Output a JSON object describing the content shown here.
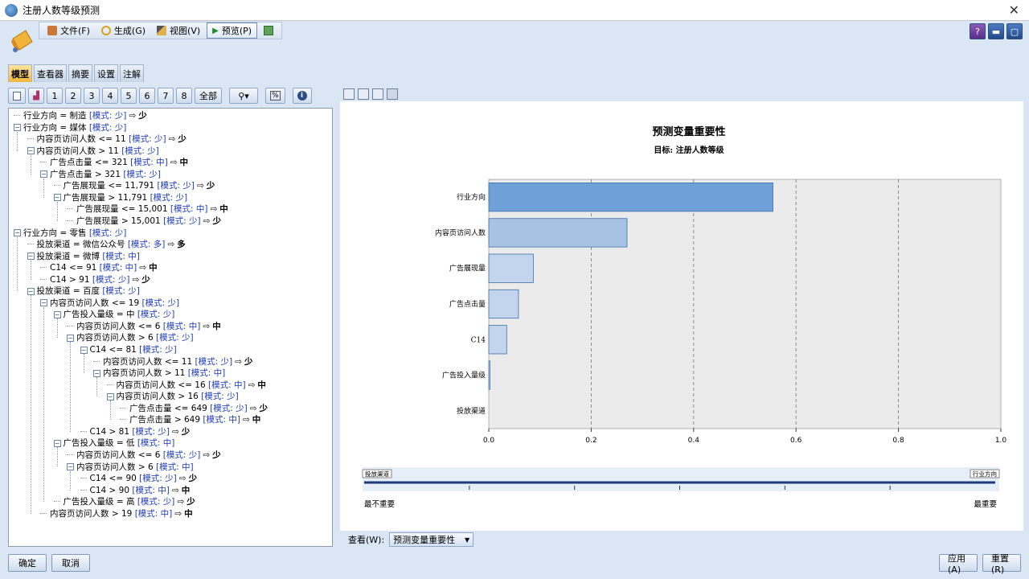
{
  "window": {
    "title": "注册人数等级预测"
  },
  "menu": {
    "file": "文件(F)",
    "generate": "生成(G)",
    "view": "视图(V)",
    "preview": "预览(P)"
  },
  "tabs": [
    "模型",
    "查看器",
    "摘要",
    "设置",
    "注解"
  ],
  "left_toolbar": {
    "levels": [
      "1",
      "2",
      "3",
      "4",
      "5",
      "6",
      "7",
      "8"
    ],
    "all": "全部",
    "pct": "%",
    "info": "i"
  },
  "tree": [
    {
      "text": "行业方向 = 制造",
      "mode": "[模式: 少]",
      "res": "少",
      "toggle": "none"
    },
    {
      "text": "行业方向 = 媒体",
      "mode": "[模式: 少]",
      "res": "",
      "toggle": "minus"
    },
    {
      "text": "内容页访问人数 <= 11",
      "mode": "[模式: 少]",
      "res": "少",
      "toggle": "none"
    },
    {
      "text": "内容页访问人数 > 11",
      "mode": "[模式: 少]",
      "res": "",
      "toggle": "minus"
    },
    {
      "text": "广告点击量 <= 321",
      "mode": "[模式: 中]",
      "res": "中",
      "toggle": "none"
    },
    {
      "text": "广告点击量 > 321",
      "mode": "[模式: 少]",
      "res": "",
      "toggle": "minus"
    },
    {
      "text": "广告展现量 <= 11,791",
      "mode": "[模式: 少]",
      "res": "少",
      "toggle": "none"
    },
    {
      "text": "广告展现量 > 11,791",
      "mode": "[模式: 少]",
      "res": "",
      "toggle": "minus"
    },
    {
      "text": "广告展现量 <= 15,001",
      "mode": "[模式: 中]",
      "res": "中",
      "toggle": "none"
    },
    {
      "text": "广告展现量 > 15,001",
      "mode": "[模式: 少]",
      "res": "少",
      "toggle": "none"
    },
    {
      "text": "行业方向 = 零售",
      "mode": "[模式: 少]",
      "res": "",
      "toggle": "minus"
    },
    {
      "text": "投放渠道 = 微信公众号",
      "mode": "[模式: 多]",
      "res": "多",
      "toggle": "none"
    },
    {
      "text": "投放渠道 = 微博",
      "mode": "[模式: 中]",
      "res": "",
      "toggle": "minus"
    },
    {
      "text": "C14 <= 91",
      "mode": "[模式: 中]",
      "res": "中",
      "toggle": "none"
    },
    {
      "text": "C14 > 91",
      "mode": "[模式: 少]",
      "res": "少",
      "toggle": "none"
    },
    {
      "text": "投放渠道 = 百度",
      "mode": "[模式: 少]",
      "res": "",
      "toggle": "minus"
    },
    {
      "text": "内容页访问人数 <= 19",
      "mode": "[模式: 少]",
      "res": "",
      "toggle": "minus"
    },
    {
      "text": "广告投入量级 = 中",
      "mode": "[模式: 少]",
      "res": "",
      "toggle": "minus"
    },
    {
      "text": "内容页访问人数 <= 6",
      "mode": "[模式: 中]",
      "res": "中",
      "toggle": "none"
    },
    {
      "text": "内容页访问人数 > 6",
      "mode": "[模式: 少]",
      "res": "",
      "toggle": "minus"
    },
    {
      "text": "C14 <= 81",
      "mode": "[模式: 少]",
      "res": "",
      "toggle": "minus"
    },
    {
      "text": "内容页访问人数 <= 11",
      "mode": "[模式: 少]",
      "res": "少",
      "toggle": "none"
    },
    {
      "text": "内容页访问人数 > 11",
      "mode": "[模式: 中]",
      "res": "",
      "toggle": "minus"
    },
    {
      "text": "内容页访问人数 <= 16",
      "mode": "[模式: 中]",
      "res": "中",
      "toggle": "none"
    },
    {
      "text": "内容页访问人数 > 16",
      "mode": "[模式: 少]",
      "res": "",
      "toggle": "minus"
    },
    {
      "text": "广告点击量 <= 649",
      "mode": "[模式: 少]",
      "res": "少",
      "toggle": "none"
    },
    {
      "text": "广告点击量 > 649",
      "mode": "[模式: 中]",
      "res": "中",
      "toggle": "none"
    },
    {
      "text": "C14 > 81",
      "mode": "[模式: 少]",
      "res": "少",
      "toggle": "none"
    },
    {
      "text": "广告投入量级 = 低",
      "mode": "[模式: 中]",
      "res": "",
      "toggle": "minus"
    },
    {
      "text": "内容页访问人数 <= 6",
      "mode": "[模式: 少]",
      "res": "少",
      "toggle": "none"
    },
    {
      "text": "内容页访问人数 > 6",
      "mode": "[模式: 中]",
      "res": "",
      "toggle": "minus"
    },
    {
      "text": "C14 <= 90",
      "mode": "[模式: 少]",
      "res": "少",
      "toggle": "none"
    },
    {
      "text": "C14 > 90",
      "mode": "[模式: 中]",
      "res": "中",
      "toggle": "none"
    },
    {
      "text": "广告投入量级 = 高",
      "mode": "[模式: 少]",
      "res": "少",
      "toggle": "none"
    },
    {
      "text": "内容页访问人数 > 19",
      "mode": "[模式: 中]",
      "res": "中",
      "toggle": "none"
    }
  ],
  "chart_data": {
    "type": "bar",
    "orientation": "horizontal",
    "title": "预测变量重要性",
    "subtitle": "目标: 注册人数等级",
    "categories": [
      "行业方向",
      "内容页访问人数",
      "广告展现量",
      "广告点击量",
      "C14",
      "广告投入量级",
      "投放渠道"
    ],
    "values": [
      0.555,
      0.27,
      0.087,
      0.058,
      0.035,
      0.002,
      0.0
    ],
    "xlim": [
      0,
      1.0
    ],
    "xticks": [
      "0.0",
      "0.2",
      "0.4",
      "0.6",
      "0.8",
      "1.0"
    ],
    "grid": true,
    "bar_color": "#6fa1d8",
    "bar_edge": "#3f6fae",
    "plot_bg": "#ebebeb"
  },
  "slider": {
    "left_tag": "投放渠道",
    "right_tag": "行业方向",
    "left_label": "最不重要",
    "right_label": "最重要"
  },
  "view_select": {
    "label": "查看(W):",
    "value": "预测变量重要性"
  },
  "buttons": {
    "ok": "确定",
    "cancel": "取消",
    "apply": "应用(A)",
    "reset": "重置(R)"
  }
}
